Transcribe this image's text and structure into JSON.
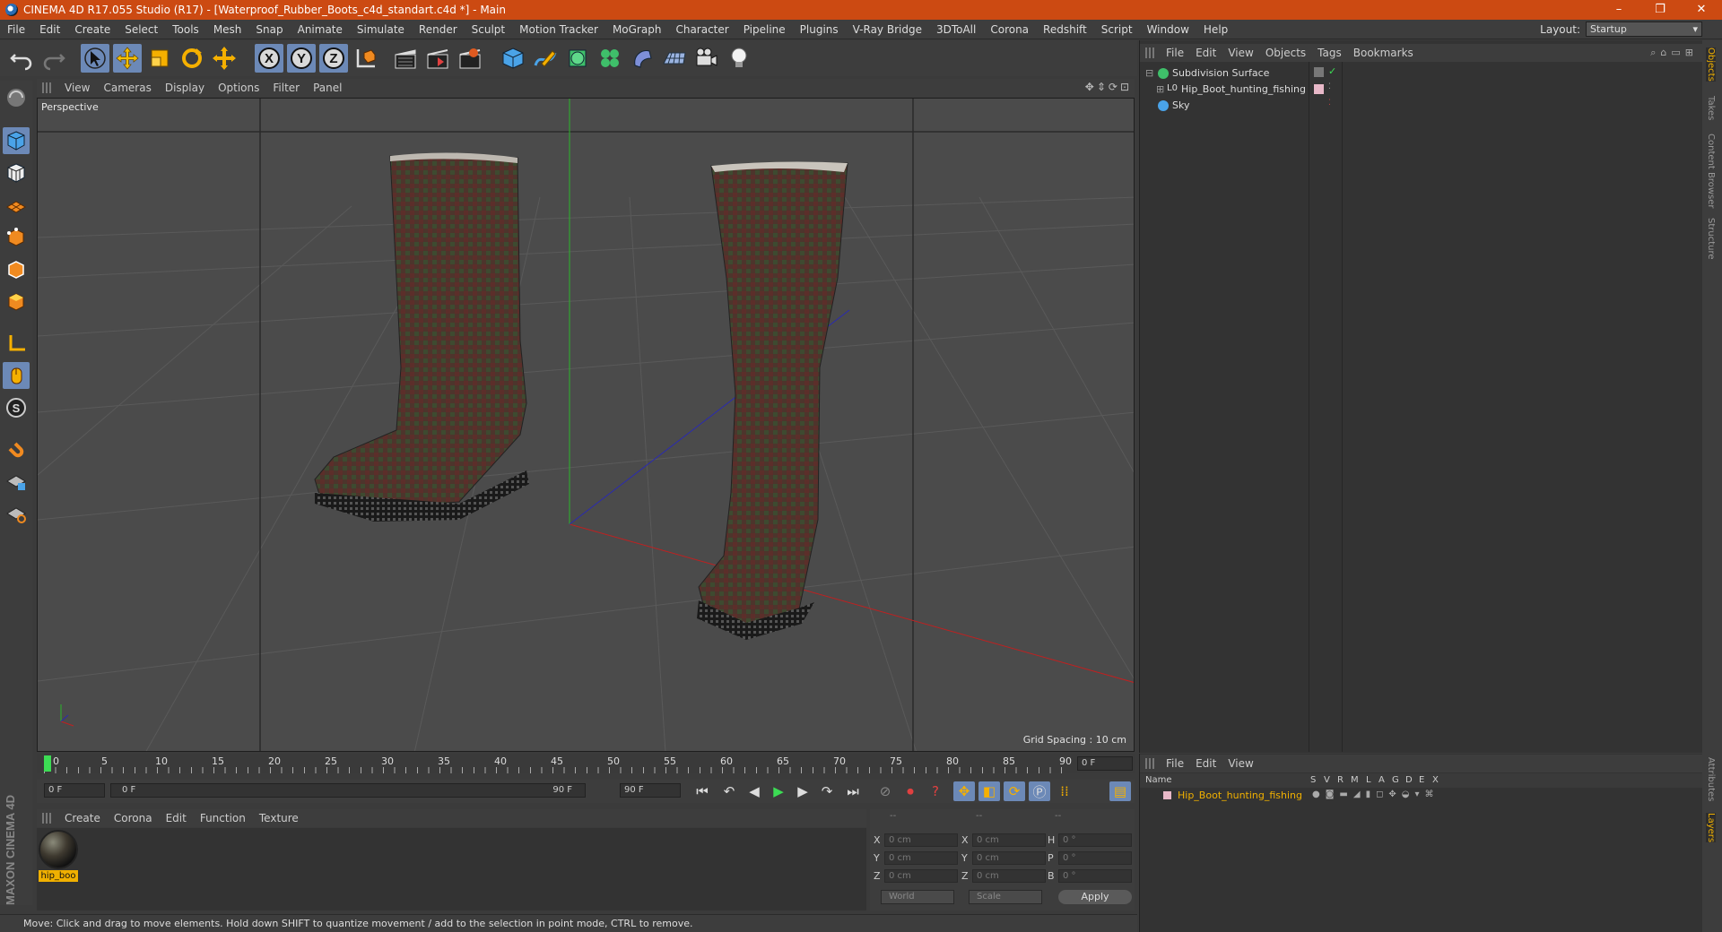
{
  "window": {
    "title": "CINEMA 4D R17.055 Studio (R17) - [Waterproof_Rubber_Boots_c4d_standart.c4d *] - Main",
    "controls": [
      "–",
      "❐",
      "✕"
    ]
  },
  "menubar": {
    "items": [
      "File",
      "Edit",
      "Create",
      "Select",
      "Tools",
      "Mesh",
      "Snap",
      "Animate",
      "Simulate",
      "Render",
      "Sculpt",
      "Motion Tracker",
      "MoGraph",
      "Character",
      "Pipeline",
      "Plugins",
      "V-Ray Bridge",
      "3DToAll",
      "Corona",
      "Redshift",
      "Script",
      "Window",
      "Help"
    ],
    "layout_label": "Layout:",
    "layout_value": "Startup"
  },
  "toolbar": {
    "axis_x": "X",
    "axis_y": "Y",
    "axis_z": "Z"
  },
  "viewport": {
    "menu": [
      "View",
      "Cameras",
      "Display",
      "Options",
      "Filter",
      "Panel"
    ],
    "label": "Perspective",
    "grid_spacing": "Grid Spacing : 10 cm"
  },
  "timeline": {
    "ticks": [
      "0",
      "5",
      "10",
      "15",
      "20",
      "25",
      "30",
      "35",
      "40",
      "45",
      "50",
      "55",
      "60",
      "65",
      "70",
      "75",
      "80",
      "85",
      "90"
    ],
    "current_frame": "0 F",
    "start_field": "0 F",
    "range_start": "0 F",
    "range_end": "90 F",
    "end_field": "90 F"
  },
  "material_manager": {
    "menu": [
      "Create",
      "Corona",
      "Edit",
      "Function",
      "Texture"
    ],
    "material_name": "hip_boo"
  },
  "coordinates": {
    "headers": [
      "--",
      "--",
      "--"
    ],
    "pos_labels": [
      "X",
      "Y",
      "Z"
    ],
    "size_labels": [
      "X",
      "Y",
      "Z"
    ],
    "rot_labels": [
      "H",
      "P",
      "B"
    ],
    "pos_values": [
      "0 cm",
      "0 cm",
      "0 cm"
    ],
    "size_values": [
      "0 cm",
      "0 cm",
      "0 cm"
    ],
    "rot_values": [
      "0 °",
      "0 °",
      "0 °"
    ],
    "space": "World",
    "mode": "Scale",
    "apply": "Apply"
  },
  "status": {
    "text": "Move: Click and drag to move elements. Hold down SHIFT to quantize movement / add to the selection in point mode, CTRL to remove."
  },
  "object_manager": {
    "menu": [
      "File",
      "Edit",
      "View",
      "Objects",
      "Tags",
      "Bookmarks"
    ],
    "objects": [
      "Subdivision Surface",
      "Hip_Boot_hunting_fishing",
      "Sky"
    ]
  },
  "layer_manager": {
    "menu": [
      "File",
      "Edit",
      "View"
    ],
    "columns": [
      "Name",
      "S",
      "V",
      "R",
      "M",
      "L",
      "A",
      "G",
      "D",
      "E",
      "X"
    ],
    "layer_name": "Hip_Boot_hunting_fishing"
  },
  "side_tabs": [
    "Objects",
    "Takes",
    "Content Browser",
    "Structure",
    "Attributes",
    "Layers"
  ],
  "colors": {
    "title_bar": "#cc4a12",
    "active_tool": "#6c89b7",
    "highlight": "#f0b000",
    "timeline_cursor": "#3cdc54"
  }
}
